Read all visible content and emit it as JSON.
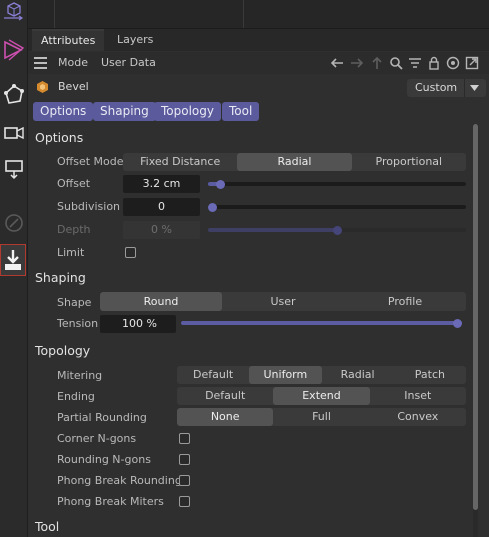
{
  "tabs": [
    "Attributes",
    "Layers"
  ],
  "menubar": {
    "mode": "Mode",
    "user_data": "User Data"
  },
  "object": {
    "name": "Bevel",
    "preset": "Custom"
  },
  "page_buttons": [
    "Options",
    "Shaping",
    "Topology",
    "Tool"
  ],
  "options": {
    "title": "Options",
    "offset_mode": {
      "label": "Offset Mode",
      "choices": [
        "Fixed Distance",
        "Radial",
        "Proportional"
      ],
      "selected": "Radial"
    },
    "offset": {
      "label": "Offset",
      "value": "3.2 cm",
      "slider": 0.05
    },
    "subdivision": {
      "label": "Subdivision",
      "value": "0",
      "slider": 0.0
    },
    "depth": {
      "label": "Depth",
      "value": "0 %",
      "slider": 0.5
    },
    "limit": {
      "label": "Limit",
      "checked": false
    }
  },
  "shaping": {
    "title": "Shaping",
    "shape": {
      "label": "Shape",
      "choices": [
        "Round",
        "User",
        "Profile"
      ],
      "selected": "Round"
    },
    "tension": {
      "label": "Tension",
      "value": "100 %",
      "slider": 1.0
    }
  },
  "topology": {
    "title": "Topology",
    "mitering": {
      "label": "Mitering",
      "choices": [
        "Default",
        "Uniform",
        "Radial",
        "Patch"
      ],
      "selected": "Uniform"
    },
    "ending": {
      "label": "Ending",
      "choices": [
        "Default",
        "Extend",
        "Inset"
      ],
      "selected": "Extend"
    },
    "partial_rounding": {
      "label": "Partial Rounding",
      "choices": [
        "None",
        "Full",
        "Convex"
      ],
      "selected": "None"
    },
    "corner_ngons": {
      "label": "Corner N-gons",
      "checked": false
    },
    "rounding_ngons": {
      "label": "Rounding N-gons",
      "checked": false
    },
    "phong_break_rounding": {
      "label": "Phong Break Rounding",
      "checked": false
    },
    "phong_break_miters": {
      "label": "Phong Break Miters",
      "checked": false
    }
  },
  "tool": {
    "title": "Tool"
  },
  "colors": {
    "accent": "#5a5a9c",
    "panel": "#2f2f2f",
    "field": "#1d1d1d"
  }
}
